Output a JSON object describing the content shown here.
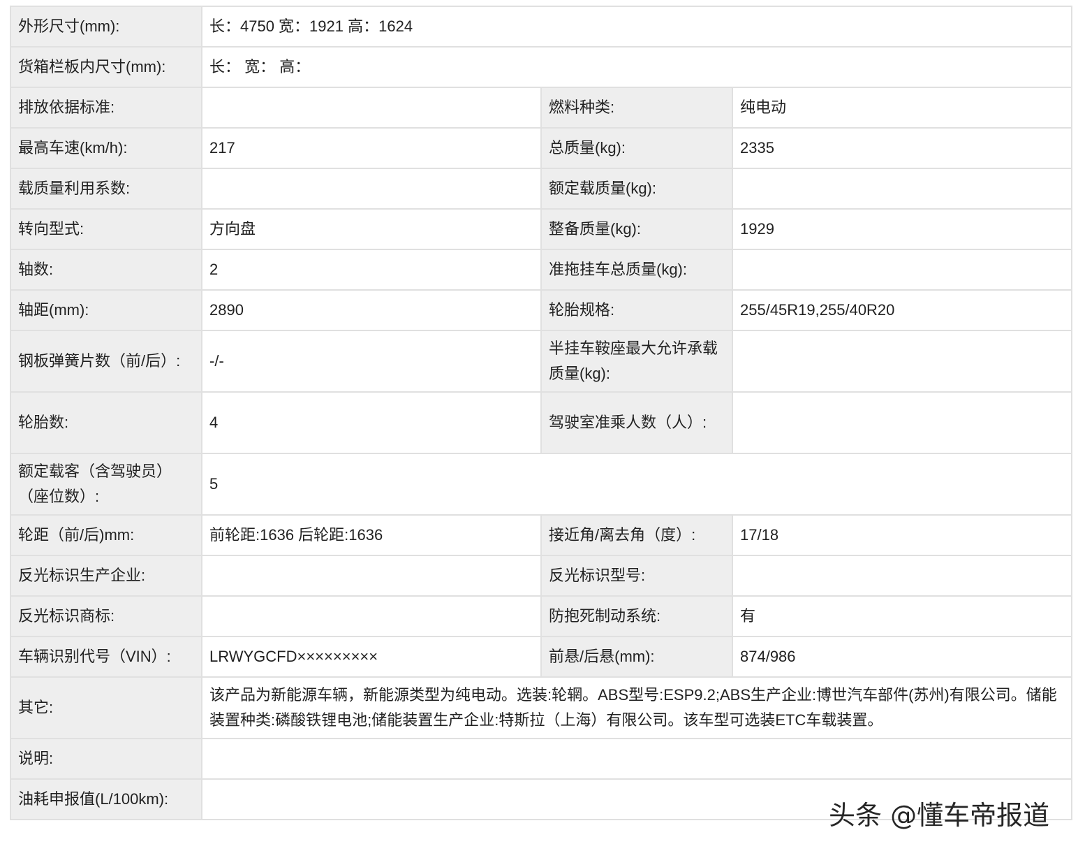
{
  "rows": [
    {
      "l1": "外形尺寸(mm):",
      "v1": "长：4750 宽：1921 高：1624"
    },
    {
      "l1": "货箱栏板内尺寸(mm):",
      "v1": "长： 宽： 高："
    },
    {
      "l1": "排放依据标准:",
      "v1": "",
      "l2": "燃料种类:",
      "v2": "纯电动"
    },
    {
      "l1": "最高车速(km/h):",
      "v1": "217",
      "l2": "总质量(kg):",
      "v2": "2335"
    },
    {
      "l1": "载质量利用系数:",
      "v1": "",
      "l2": "额定载质量(kg):",
      "v2": ""
    },
    {
      "l1": "转向型式:",
      "v1": "方向盘",
      "l2": "整备质量(kg):",
      "v2": "1929"
    },
    {
      "l1": "轴数:",
      "v1": "2",
      "l2": "准拖挂车总质量(kg):",
      "v2": ""
    },
    {
      "l1": "轴距(mm):",
      "v1": "2890",
      "l2": "轮胎规格:",
      "v2": "255/45R19,255/40R20"
    },
    {
      "l1": "钢板弹簧片数（前/后）:",
      "v1": "-/-",
      "l2": "半挂车鞍座最大允许承载质量(kg):",
      "v2": ""
    },
    {
      "l1": "轮胎数:",
      "v1": "4",
      "l2": "驾驶室准乘人数（人）:",
      "v2": ""
    },
    {
      "l1": "额定载客（含驾驶员）（座位数）:",
      "v1": "5"
    },
    {
      "l1": "轮距（前/后)mm:",
      "v1": "前轮距:1636 后轮距:1636",
      "l2": "接近角/离去角（度）:",
      "v2": "17/18"
    },
    {
      "l1": "反光标识生产企业:",
      "v1": "",
      "l2": "反光标识型号:",
      "v2": ""
    },
    {
      "l1": "反光标识商标:",
      "v1": "",
      "l2": "防抱死制动系统:",
      "v2": "有"
    },
    {
      "l1": "车辆识别代号（VIN）:",
      "v1": "LRWYGCFD×××××××××",
      "l2": "前悬/后悬(mm):",
      "v2": "874/986"
    },
    {
      "l1": "其它:",
      "v1": "该产品为新能源车辆，新能源类型为纯电动。选装:轮辋。ABS型号:ESP9.2;ABS生产企业:博世汽车部件(苏州)有限公司。储能装置种类:磷酸铁锂电池;储能装置生产企业:特斯拉（上海）有限公司。该车型可选装ETC车载装置。"
    },
    {
      "l1": "说明:",
      "v1": ""
    },
    {
      "l1": "油耗申报值(L/100km):",
      "v1": ""
    }
  ],
  "watermark": "头条 @懂车帝报道"
}
